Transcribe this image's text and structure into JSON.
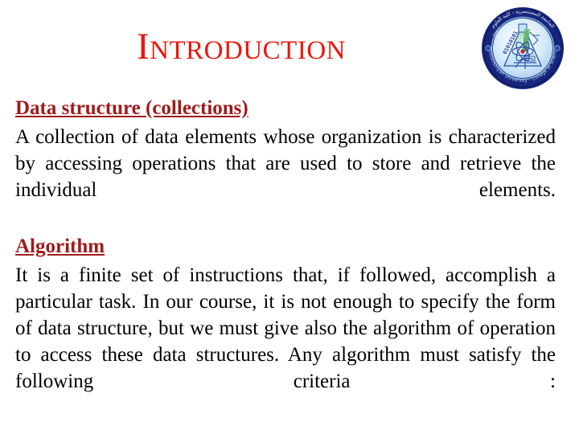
{
  "slide": {
    "background_color": "#ffffff",
    "title": "Introduction",
    "title_color": "#e8170c",
    "heading_color": "#9e1b1b",
    "body_color": "#000000"
  },
  "logo": {
    "name": "mustansiriyah-university-college-of-science-seal",
    "outer_ring_color": "#1b2f8a",
    "inner_disc_color": "#cfe4f7",
    "arabic_text": "الجامعة المستنصرية - كلية العلوم",
    "latin_text": "Mustansiriyah University - College of Science",
    "year_text": "1963",
    "binary_text": "01010101"
  },
  "sections": [
    {
      "heading": "Data structure (collections)",
      "paragraph": "A collection of data elements whose organization is characterized by accessing operations that are used to store and retrieve the individual elements."
    },
    {
      "heading": "Algorithm",
      "paragraph": "It is a finite set of instructions that, if followed, accomplish a particular task. In our course, it is not enough to specify the form of data structure, but we must give also the algorithm of operation to access these data structures. Any algorithm must satisfy the following criteria :"
    }
  ]
}
